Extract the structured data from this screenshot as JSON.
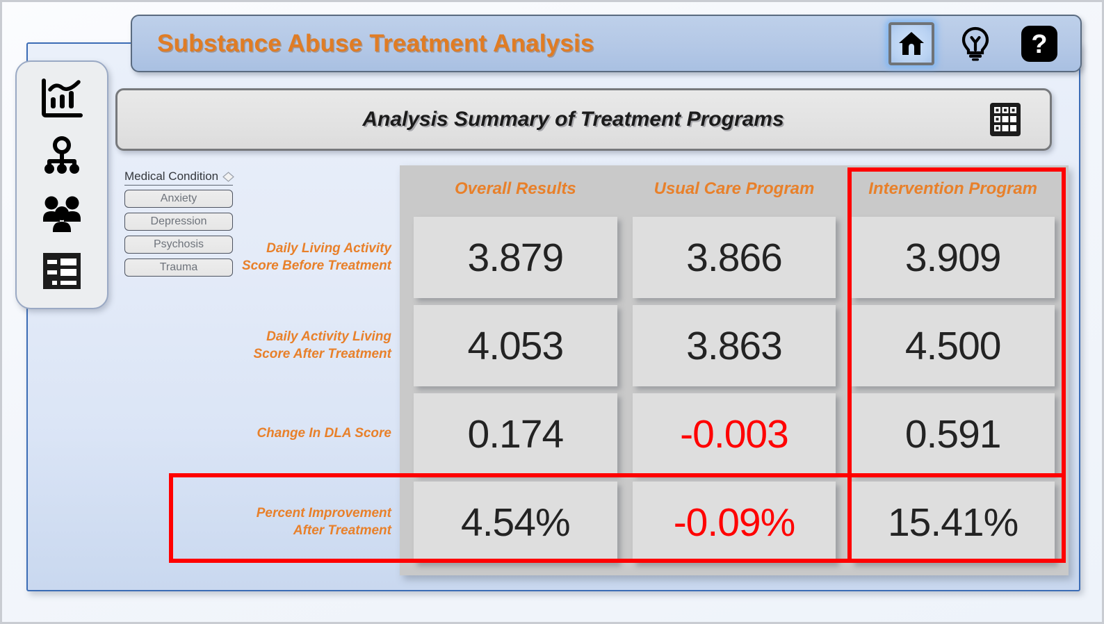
{
  "header": {
    "app_title": "Substance Abuse Treatment Analysis",
    "home_icon": "home-icon",
    "hint_icon": "lightbulb-icon",
    "help_icon": "question-mark-icon"
  },
  "subtitle": {
    "text": "Analysis Summary of Treatment Programs",
    "grid_icon": "grid-table-icon"
  },
  "sidebar": {
    "items": [
      {
        "icon": "bar-line-chart-icon",
        "name": "sidebar-item-analytics"
      },
      {
        "icon": "org-hierarchy-icon",
        "name": "sidebar-item-hierarchy"
      },
      {
        "icon": "people-group-icon",
        "name": "sidebar-item-demographics"
      },
      {
        "icon": "report-table-icon",
        "name": "sidebar-item-report"
      }
    ]
  },
  "filter": {
    "title": "Medical Condition",
    "clear_icon": "eraser-icon",
    "options": [
      "Anxiety",
      "Depression",
      "Psychosis",
      "Trauma"
    ]
  },
  "colors": {
    "accent_orange": "#e8802a",
    "title_orange": "#e07c24",
    "negative_red": "#ff0000",
    "highlight_red": "#ff0000",
    "panel_blue": "#dbe5f6",
    "titlebar_blue": "#b4c8e6",
    "tile_grey": "#dedede",
    "table_grey": "#c9c9c9"
  },
  "chart_data": {
    "type": "table",
    "title": "Analysis Summary of Treatment Programs",
    "columns": [
      "Overall Results",
      "Usual Care Program",
      "Intervention Program"
    ],
    "rows": [
      {
        "label": "Daily Living Activity Score Before Treatment",
        "values": [
          "3.879",
          "3.866",
          "3.909"
        ],
        "negative": [
          false,
          false,
          false
        ]
      },
      {
        "label": "Daily Activity Living Score After Treatment",
        "values": [
          "4.053",
          "3.863",
          "4.500"
        ],
        "negative": [
          false,
          false,
          false
        ]
      },
      {
        "label": "Change In DLA Score",
        "values": [
          "0.174",
          "-0.003",
          "0.591"
        ],
        "negative": [
          false,
          true,
          false
        ]
      },
      {
        "label": "Percent Improvement After Treatment",
        "values": [
          "4.54%",
          "-0.09%",
          "15.41%"
        ],
        "negative": [
          false,
          true,
          false
        ]
      }
    ],
    "highlighted_column": "Intervention Program",
    "highlighted_row": "Percent Improvement After Treatment"
  }
}
